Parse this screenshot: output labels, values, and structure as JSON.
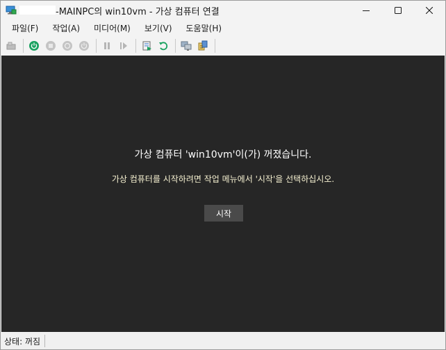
{
  "window": {
    "title": "-MAINPC의 win10vm - 가상 컴퓨터 연결"
  },
  "menu": [
    {
      "label": "파일(F)"
    },
    {
      "label": "작업(A)"
    },
    {
      "label": "미디어(M)"
    },
    {
      "label": "보기(V)"
    },
    {
      "label": "도움말(H)"
    }
  ],
  "toolbar": {
    "icons": [
      "ctrl-alt-del-icon",
      "start-icon",
      "turn-off-icon",
      "shut-down-icon",
      "save-icon",
      "pause-icon",
      "reset-icon",
      "checkpoint-icon",
      "revert-icon",
      "enhanced-session-icon",
      "share-icon"
    ]
  },
  "display": {
    "message": "가상 컴퓨터 'win10vm'이(가) 꺼졌습니다.",
    "hint": "가상 컴퓨터를 시작하려면 작업 메뉴에서 '시작'을 선택하십시오.",
    "start_label": "시작"
  },
  "status": {
    "text": "상태: 꺼짐"
  },
  "colors": {
    "display_bg": "#262626",
    "hint_text": "#f5f0d0",
    "start_button": "#4a4a4a",
    "start_green": "#1aa260"
  }
}
